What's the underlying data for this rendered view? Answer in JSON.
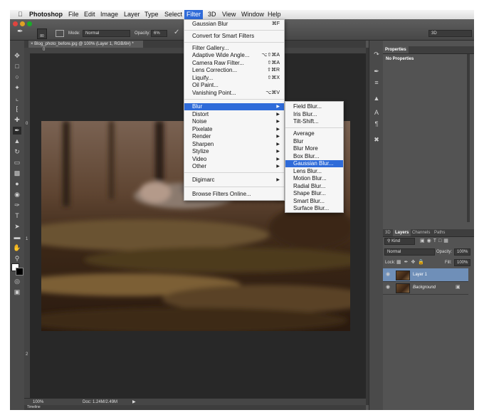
{
  "menubar": {
    "app_name": "Photoshop",
    "items": [
      "File",
      "Edit",
      "Image",
      "Layer",
      "Type",
      "Select",
      "Filter",
      "3D",
      "View",
      "Window",
      "Help"
    ]
  },
  "options_bar": {
    "brush_size": "80",
    "mode_label": "Mode:",
    "mode_value": "Normal",
    "opacity_label": "Opacity:",
    "opacity_value": "6%",
    "workspace": "3D"
  },
  "document": {
    "tab_title": "Blog_photo_before.jpg @ 100% (Layer 1, RGB/8#) *",
    "ruler_top": [
      "0"
    ],
    "ruler_left": [
      "0",
      "1",
      "2"
    ],
    "zoom": "100%",
    "doc_size": "Doc: 1.24M/2.49M",
    "timeline_label": "Timeline"
  },
  "filter_menu": {
    "items": [
      {
        "label": "Gaussian Blur",
        "shortcut": "⌘F"
      },
      {
        "label": "Convert for Smart Filters",
        "shortcut": ""
      },
      {
        "label": "Filter Gallery...",
        "shortcut": ""
      },
      {
        "label": "Adaptive Wide Angle...",
        "shortcut": "⌥⇧⌘A"
      },
      {
        "label": "Camera Raw Filter...",
        "shortcut": "⇧⌘A"
      },
      {
        "label": "Lens Correction...",
        "shortcut": "⇧⌘R"
      },
      {
        "label": "Liquify...",
        "shortcut": "⇧⌘X"
      },
      {
        "label": "Oil Paint...",
        "shortcut": ""
      },
      {
        "label": "Vanishing Point...",
        "shortcut": "⌥⌘V"
      },
      {
        "label": "Blur",
        "shortcut": ""
      },
      {
        "label": "Distort",
        "shortcut": ""
      },
      {
        "label": "Noise",
        "shortcut": ""
      },
      {
        "label": "Pixelate",
        "shortcut": ""
      },
      {
        "label": "Render",
        "shortcut": ""
      },
      {
        "label": "Sharpen",
        "shortcut": ""
      },
      {
        "label": "Stylize",
        "shortcut": ""
      },
      {
        "label": "Video",
        "shortcut": ""
      },
      {
        "label": "Other",
        "shortcut": ""
      },
      {
        "label": "Digimarc",
        "shortcut": ""
      },
      {
        "label": "Browse Filters Online...",
        "shortcut": ""
      }
    ]
  },
  "blur_submenu": {
    "items": [
      "Field Blur...",
      "Iris Blur...",
      "Tilt-Shift...",
      "Average",
      "Blur",
      "Blur More",
      "Box Blur...",
      "Gaussian Blur...",
      "Lens Blur...",
      "Motion Blur...",
      "Radial Blur...",
      "Shape Blur...",
      "Smart Blur...",
      "Surface Blur..."
    ],
    "highlighted": "Gaussian Blur..."
  },
  "properties_panel": {
    "tab": "Properties",
    "message": "No Properties"
  },
  "layers_panel": {
    "tabs": [
      "3D",
      "Layers",
      "Channels",
      "Paths"
    ],
    "kind_filter": "Kind",
    "blend_mode": "Normal",
    "opacity_label": "Opacity:",
    "opacity_value": "100%",
    "lock_label": "Lock:",
    "fill_label": "Fill:",
    "fill_value": "100%",
    "layers": [
      {
        "name": "Layer 1",
        "selected": true
      },
      {
        "name": "Background",
        "selected": false
      }
    ]
  }
}
